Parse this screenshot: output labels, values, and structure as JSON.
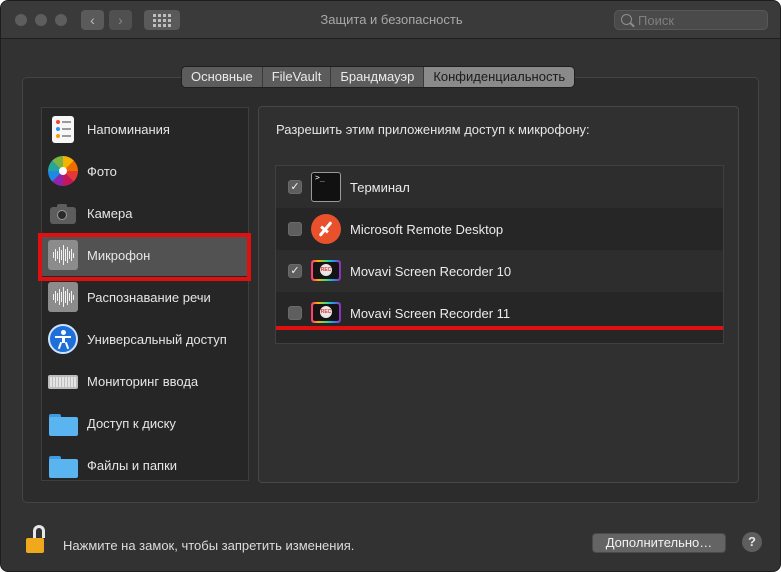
{
  "window": {
    "title": "Защита и безопасность",
    "search_placeholder": "Поиск",
    "back_glyph": "‹",
    "forward_glyph": "›"
  },
  "tabs": [
    {
      "label": "Основные",
      "active": false
    },
    {
      "label": "FileVault",
      "active": false
    },
    {
      "label": "Брандмауэр",
      "active": false
    },
    {
      "label": "Конфиденциальность",
      "active": true
    }
  ],
  "sidebar": {
    "items": [
      {
        "label": "Напоминания",
        "icon": "reminders-icon"
      },
      {
        "label": "Фото",
        "icon": "photos-icon"
      },
      {
        "label": "Камера",
        "icon": "camera-icon"
      },
      {
        "label": "Микрофон",
        "icon": "microphone-waveform-icon",
        "selected": true
      },
      {
        "label": "Распознавание речи",
        "icon": "speech-waveform-icon"
      },
      {
        "label": "Универсальный доступ",
        "icon": "accessibility-icon"
      },
      {
        "label": "Мониторинг ввода",
        "icon": "keyboard-icon"
      },
      {
        "label": "Доступ к диску",
        "icon": "folder-icon"
      },
      {
        "label": "Файлы и папки",
        "icon": "folder-icon"
      }
    ]
  },
  "main": {
    "prompt": "Разрешить этим приложениям доступ к микрофону:",
    "apps": [
      {
        "name": "Терминал",
        "checked": true,
        "icon": "terminal-icon"
      },
      {
        "name": "Microsoft Remote Desktop",
        "checked": false,
        "icon": "remote-desktop-icon"
      },
      {
        "name": "Movavi Screen Recorder 10",
        "checked": true,
        "icon": "movavi-icon"
      },
      {
        "name": "Movavi Screen Recorder 11",
        "checked": false,
        "icon": "movavi-icon"
      }
    ]
  },
  "footer": {
    "lock_text": "Нажмите на замок, чтобы запретить изменения.",
    "advanced_button": "Дополнительно…",
    "help_button": "?"
  },
  "annotations": {
    "highlight_color": "#e01010"
  },
  "colors": {
    "window_bg": "#323232",
    "sidebar_selected": "#525252",
    "lock_color": "#f0a81c"
  }
}
